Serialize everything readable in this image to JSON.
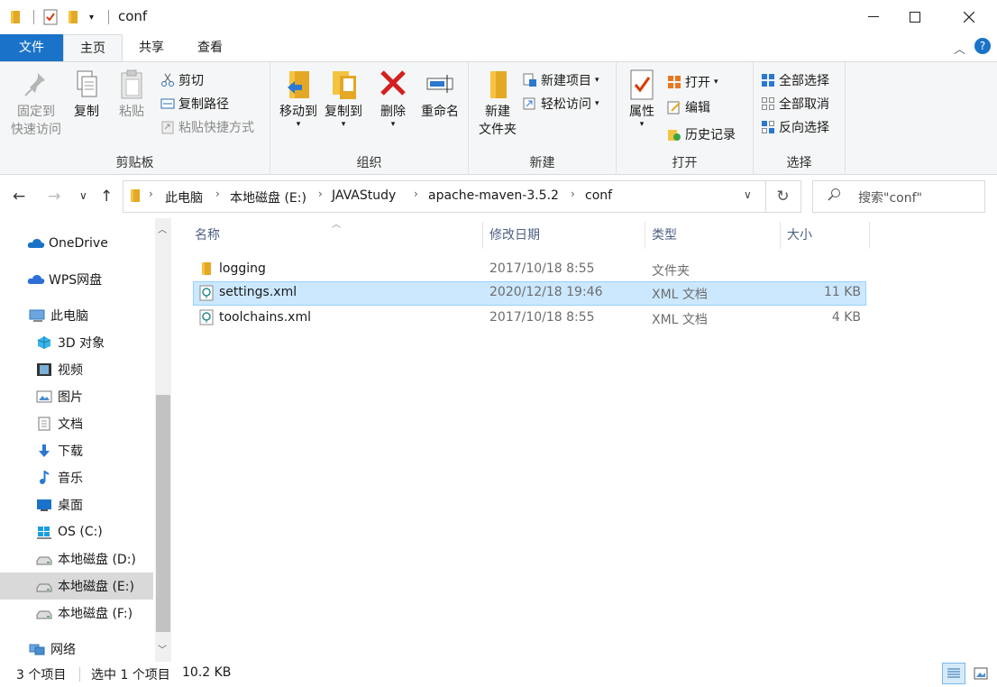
{
  "window": {
    "title": "conf"
  },
  "tabs": {
    "file": "文件",
    "home": "主页",
    "share": "共享",
    "view": "查看"
  },
  "ribbon": {
    "clipboard": {
      "label": "剪贴板",
      "pin_l1": "固定到",
      "pin_l2": "快速访问",
      "copy": "复制",
      "paste": "粘贴",
      "cut": "剪切",
      "copy_path": "复制路径",
      "paste_shortcut": "粘贴快捷方式"
    },
    "organize": {
      "label": "组织",
      "move_to": "移动到",
      "copy_to": "复制到",
      "delete": "删除",
      "rename": "重命名"
    },
    "new": {
      "label": "新建",
      "new_folder_l1": "新建",
      "new_folder_l2": "文件夹",
      "new_item": "新建项目",
      "easy_access": "轻松访问"
    },
    "open": {
      "label": "打开",
      "properties": "属性",
      "open": "打开",
      "edit": "编辑",
      "history": "历史记录"
    },
    "select": {
      "label": "选择",
      "select_all": "全部选择",
      "select_none": "全部取消",
      "invert": "反向选择"
    }
  },
  "address": {
    "crumbs": [
      "此电脑",
      "本地磁盘 (E:)",
      "JAVAStudy",
      "apache-maven-3.5.2",
      "conf"
    ],
    "search_placeholder": "搜索\"conf\""
  },
  "nav": {
    "items": [
      "OneDrive",
      "WPS网盘",
      "此电脑",
      "3D 对象",
      "视频",
      "图片",
      "文档",
      "下载",
      "音乐",
      "桌面",
      "OS (C:)",
      "本地磁盘 (D:)",
      "本地磁盘 (E:)",
      "本地磁盘 (F:)",
      "网络"
    ]
  },
  "columns": {
    "name": "名称",
    "modified": "修改日期",
    "type": "类型",
    "size": "大小"
  },
  "files": [
    {
      "name": "logging",
      "modified": "2017/10/18 8:55",
      "type": "文件夹",
      "size": ""
    },
    {
      "name": "settings.xml",
      "modified": "2020/12/18 19:46",
      "type": "XML 文档",
      "size": "11 KB"
    },
    {
      "name": "toolchains.xml",
      "modified": "2017/10/18 8:55",
      "type": "XML 文档",
      "size": "4 KB"
    }
  ],
  "status": {
    "count": "3 个项目",
    "selected": "选中 1 个项目",
    "size": "10.2 KB"
  },
  "colors": {
    "accent": "#1a73c8",
    "selection": "#cce8ff",
    "selection_border": "#99d1ff"
  }
}
